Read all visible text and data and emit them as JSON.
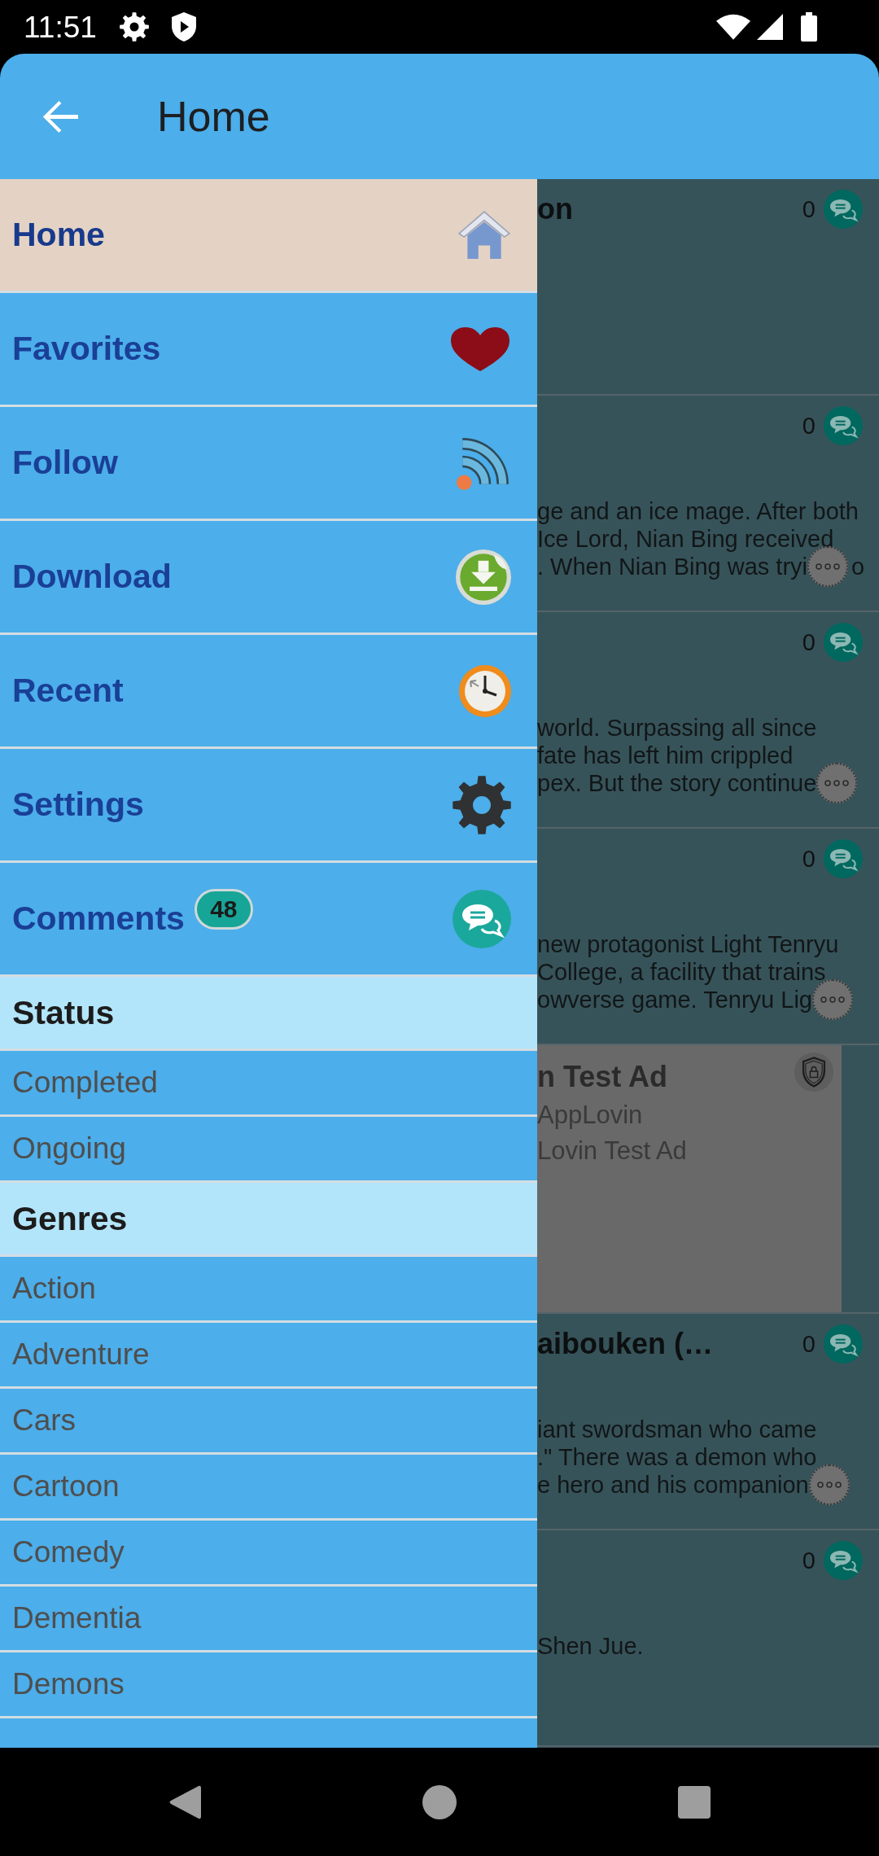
{
  "status_bar": {
    "time": "11:51"
  },
  "app_bar": {
    "title": "Home"
  },
  "drawer": {
    "menu": [
      {
        "label": "Home",
        "selected": true
      },
      {
        "label": "Favorites",
        "selected": false
      },
      {
        "label": "Follow",
        "selected": false
      },
      {
        "label": "Download",
        "selected": false
      },
      {
        "label": "Recent",
        "selected": false
      },
      {
        "label": "Settings",
        "selected": false
      },
      {
        "label": "Comments",
        "selected": false,
        "badge": "48"
      }
    ],
    "sections": [
      {
        "title": "Status",
        "items": [
          "Completed",
          "Ongoing"
        ]
      },
      {
        "title": "Genres",
        "items": [
          "Action",
          "Adventure",
          "Cars",
          "Cartoon",
          "Comedy",
          "Dementia",
          "Demons"
        ]
      }
    ]
  },
  "cards": [
    {
      "kind": "story",
      "title": "on",
      "comment_count": "0"
    },
    {
      "kind": "story",
      "comment_count": "0",
      "description": [
        "ge and an ice mage. After both",
        "Ice Lord, Nian Bing received",
        ". When Nian Bing was tryi"
      ],
      "more_button": true,
      "after_more": "o"
    },
    {
      "kind": "story",
      "comment_count": "0",
      "description": [
        "world. Surpassing all since",
        "fate has left him crippled",
        "pex. But the story continue"
      ],
      "more_button": true
    },
    {
      "kind": "story",
      "comment_count": "0",
      "description": [
        "new protagonist Light Tenryu",
        "College, a facility that trains",
        "owverse game. Tenryu Lig"
      ],
      "more_button": true
    },
    {
      "kind": "ad",
      "title": "n Test Ad",
      "lines": [
        "AppLovin",
        "Lovin Test Ad"
      ]
    },
    {
      "kind": "story",
      "title": "aibouken (…",
      "comment_count": "0",
      "description": [
        "iant swordsman who came",
        ".\" There was a demon who",
        "e hero and his companion"
      ],
      "more_button": true
    },
    {
      "kind": "story",
      "comment_count": "0",
      "description": [
        "Shen Jue."
      ]
    }
  ]
}
